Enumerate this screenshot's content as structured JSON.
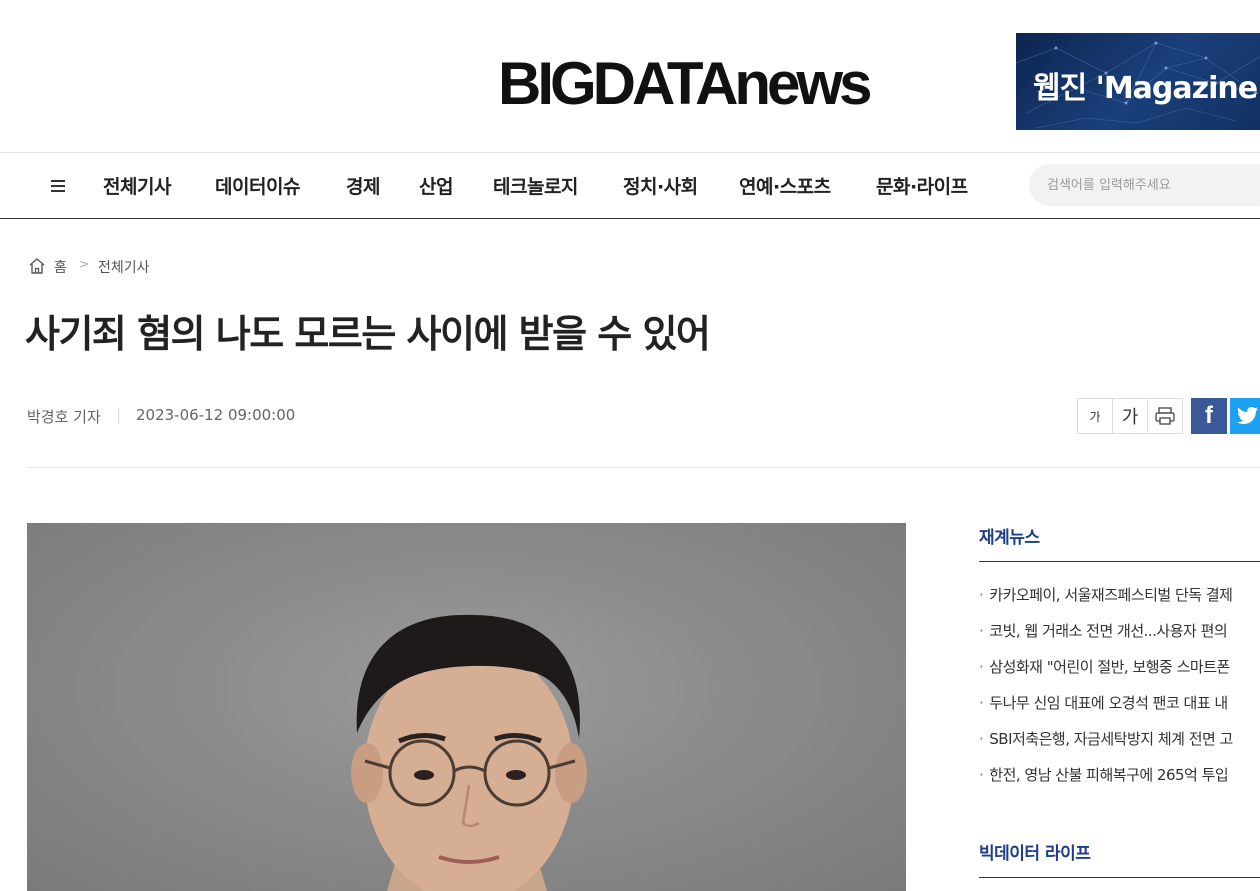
{
  "header": {
    "logo_text": "BIGDATAnews",
    "ad_text": "웹진 'Magazine I"
  },
  "nav": {
    "menu_icon": "hamburger-icon",
    "items": [
      "전체기사",
      "데이터이슈",
      "경제",
      "산업",
      "테크놀로지",
      "정치·사회",
      "연예·스포츠",
      "문화·라이프"
    ],
    "search_placeholder": "검색어를 입력해주세요"
  },
  "breadcrumb": {
    "home_icon": "home-icon",
    "home": "홈",
    "separator": ">",
    "category": "전체기사"
  },
  "article": {
    "title": "사기죄 혐의 나도 모르는 사이에 받을 수 있어",
    "author": "박경호 기자",
    "date": "2023-06-12 09:00:00"
  },
  "tools": {
    "font_small": "가",
    "font_large": "가",
    "print_icon": "printer-icon",
    "facebook": "f",
    "twitter_icon": "twitter-bird-icon"
  },
  "sidebar": {
    "section1_title": "재계뉴스",
    "news": [
      "카카오페이, 서울재즈페스티벌 단독 결제",
      "코빗, 웹 거래소 전면 개선...사용자 편의",
      "삼성화재 \"어린이 절반, 보행중 스마트폰",
      "두나무 신임 대표에 오경석 팬코 대표 내",
      "SBI저축은행, 자금세탁방지 체계 전면 고",
      "한전, 영남 산불 피해복구에 265억 투입"
    ],
    "bullet": "·",
    "section2_title": "빅데이터 라이프"
  },
  "colors": {
    "accent": "#1d3f8a",
    "facebook": "#3b5998",
    "twitter": "#1da1f2",
    "ad_background": "#12305f"
  }
}
